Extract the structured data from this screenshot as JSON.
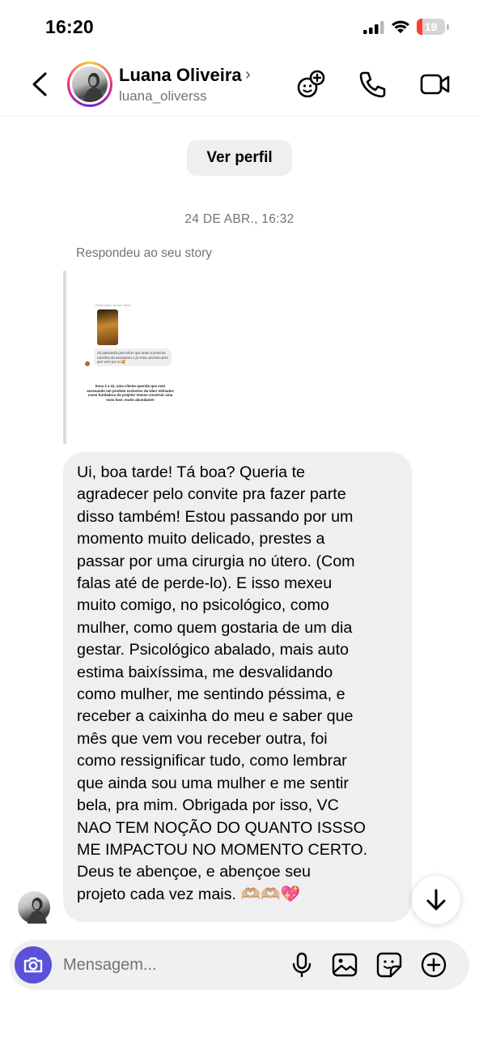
{
  "status_bar": {
    "time": "16:20",
    "battery_level": "19",
    "battery_color": "#ff3b30"
  },
  "header": {
    "name": "Luana Oliveira",
    "chevron": "›",
    "username": "luana_oliverss",
    "icons": [
      "back-icon",
      "add-story-icon",
      "phone-icon",
      "video-icon"
    ]
  },
  "chat": {
    "view_profile_label": "Ver perfil",
    "timestamp": "24 DE ABR., 16:32",
    "story_reply_label": "Respondeu ao seu story",
    "story_preview": {
      "mini_label": "Respondeu ao seu story",
      "mini_message": "Só passando para dizer que amei a primeira caixinha da assinatura e já estou ansiosa pelo que vem por aí 🥰",
      "caption": "Essa é a Gi, uma cliente querida que está acessando um produto exclusivo da Uber Intimates como fundadora do projeto! Vamos construir uma nova fase, muito abundante!"
    },
    "message_lines": [
      "Ui, boa tarde! Tá boa? Queria te",
      "agradecer pelo convite pra fazer parte",
      "disso também! Estou passando por um",
      "momento muito delicado, prestes a",
      "passar por uma cirurgia no útero. (Com",
      "falas até de perde-lo). E isso mexeu",
      "muito comigo, no psicológico, como",
      "mulher, como quem gostaria de um dia",
      "gestar. Psicológico abalado, mais auto",
      "estima baixíssima, me desvalidando",
      "como mulher, me sentindo péssima, e",
      "receber a caixinha do meu e saber que",
      "mês que vem vou receber outra, foi",
      "como ressignificar tudo, como lembrar",
      "que ainda sou uma mulher e me sentir",
      "bela, pra mim. Obrigada por isso, VC",
      "NAO TEM NOÇÃO DO QUANTO ISSSO",
      "ME IMPACTOU NO MOMENTO CERTO.",
      "Deus te abençoe, e abençoe seu",
      "projeto cada vez mais. 🫶🏼🫶🏼💖"
    ]
  },
  "composer": {
    "placeholder": "Mensagem...",
    "accent_color": "#5b51d8",
    "icons": [
      "camera-icon",
      "microphone-icon",
      "gallery-icon",
      "sticker-icon",
      "plus-icon"
    ]
  }
}
